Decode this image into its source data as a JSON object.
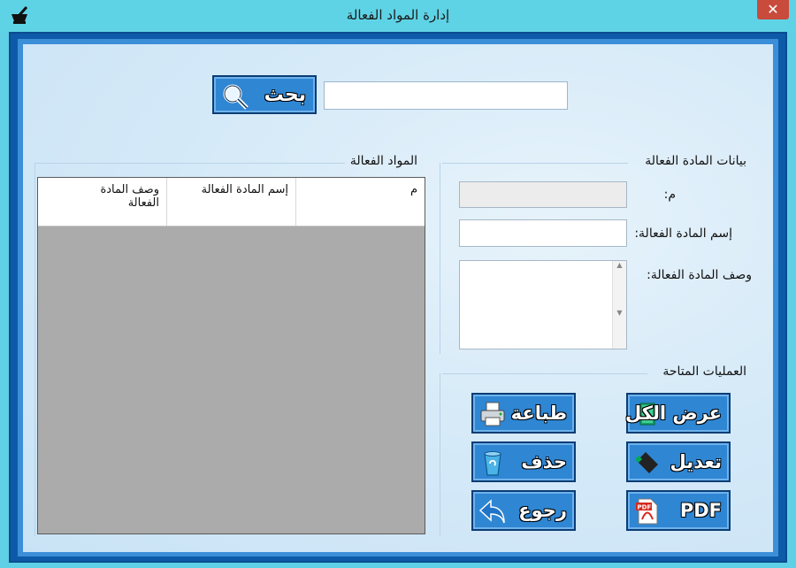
{
  "window": {
    "title": "إدارة المواد الفعالة",
    "close_glyph": "✕"
  },
  "search": {
    "button_label": "بحث",
    "value": "",
    "placeholder": ""
  },
  "list_group": {
    "title": "المواد الفعالة",
    "columns": [
      "م",
      "إسم المادة الفعالة",
      "وصف المادة الفعالة"
    ]
  },
  "details_group": {
    "title": "بيانات المادة الفعالة",
    "id_label": "م:",
    "name_label": "إسم المادة الفعالة:",
    "desc_label": "وصف المادة الفعالة:",
    "id_value": "",
    "name_value": "",
    "desc_value": ""
  },
  "operations": {
    "title": "العمليات المتاحة",
    "show_all": "عرض الكل",
    "print": "طباعة",
    "edit": "تعديل",
    "delete": "حذف",
    "pdf": "PDF",
    "back": "رجوع"
  },
  "icons": {
    "app": "mortar-pestle-icon",
    "search": "magnifier-icon",
    "show_all": "book-icon",
    "print": "printer-icon",
    "edit": "marker-icon",
    "delete": "recycle-bin-icon",
    "pdf": "pdf-file-icon",
    "back": "back-arrow-icon"
  },
  "colors": {
    "titlebar": "#5fd3e6",
    "frame": "#0d5aa8",
    "button": "#2f86d3",
    "grid_background": "#ababab"
  }
}
